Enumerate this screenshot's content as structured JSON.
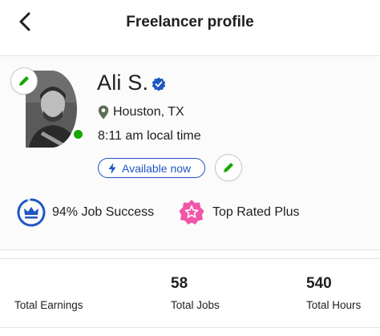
{
  "header": {
    "title": "Freelancer profile",
    "back_icon": "chevron-left-icon"
  },
  "profile": {
    "name": "Ali S.",
    "verified_icon": "verified-badge-icon",
    "location": "Houston, TX",
    "local_time": "8:11 am local time",
    "availability": "Available now",
    "online": true,
    "badges": [
      {
        "label": "94% Job Success",
        "icon": "crown-icon",
        "value": 0.94
      },
      {
        "label": "Top Rated Plus",
        "icon": "star-icon"
      }
    ]
  },
  "stats": {
    "earnings": {
      "value": "",
      "label": "Total Earnings"
    },
    "jobs": {
      "value": "58",
      "label": "Total Jobs"
    },
    "hours": {
      "value": "540",
      "label": "Total Hours"
    }
  },
  "colors": {
    "accent_green": "#14a800",
    "accent_blue": "#1f57c3",
    "top_rated_pink": "#f057a8",
    "job_success_blue": "#1f57c3"
  }
}
